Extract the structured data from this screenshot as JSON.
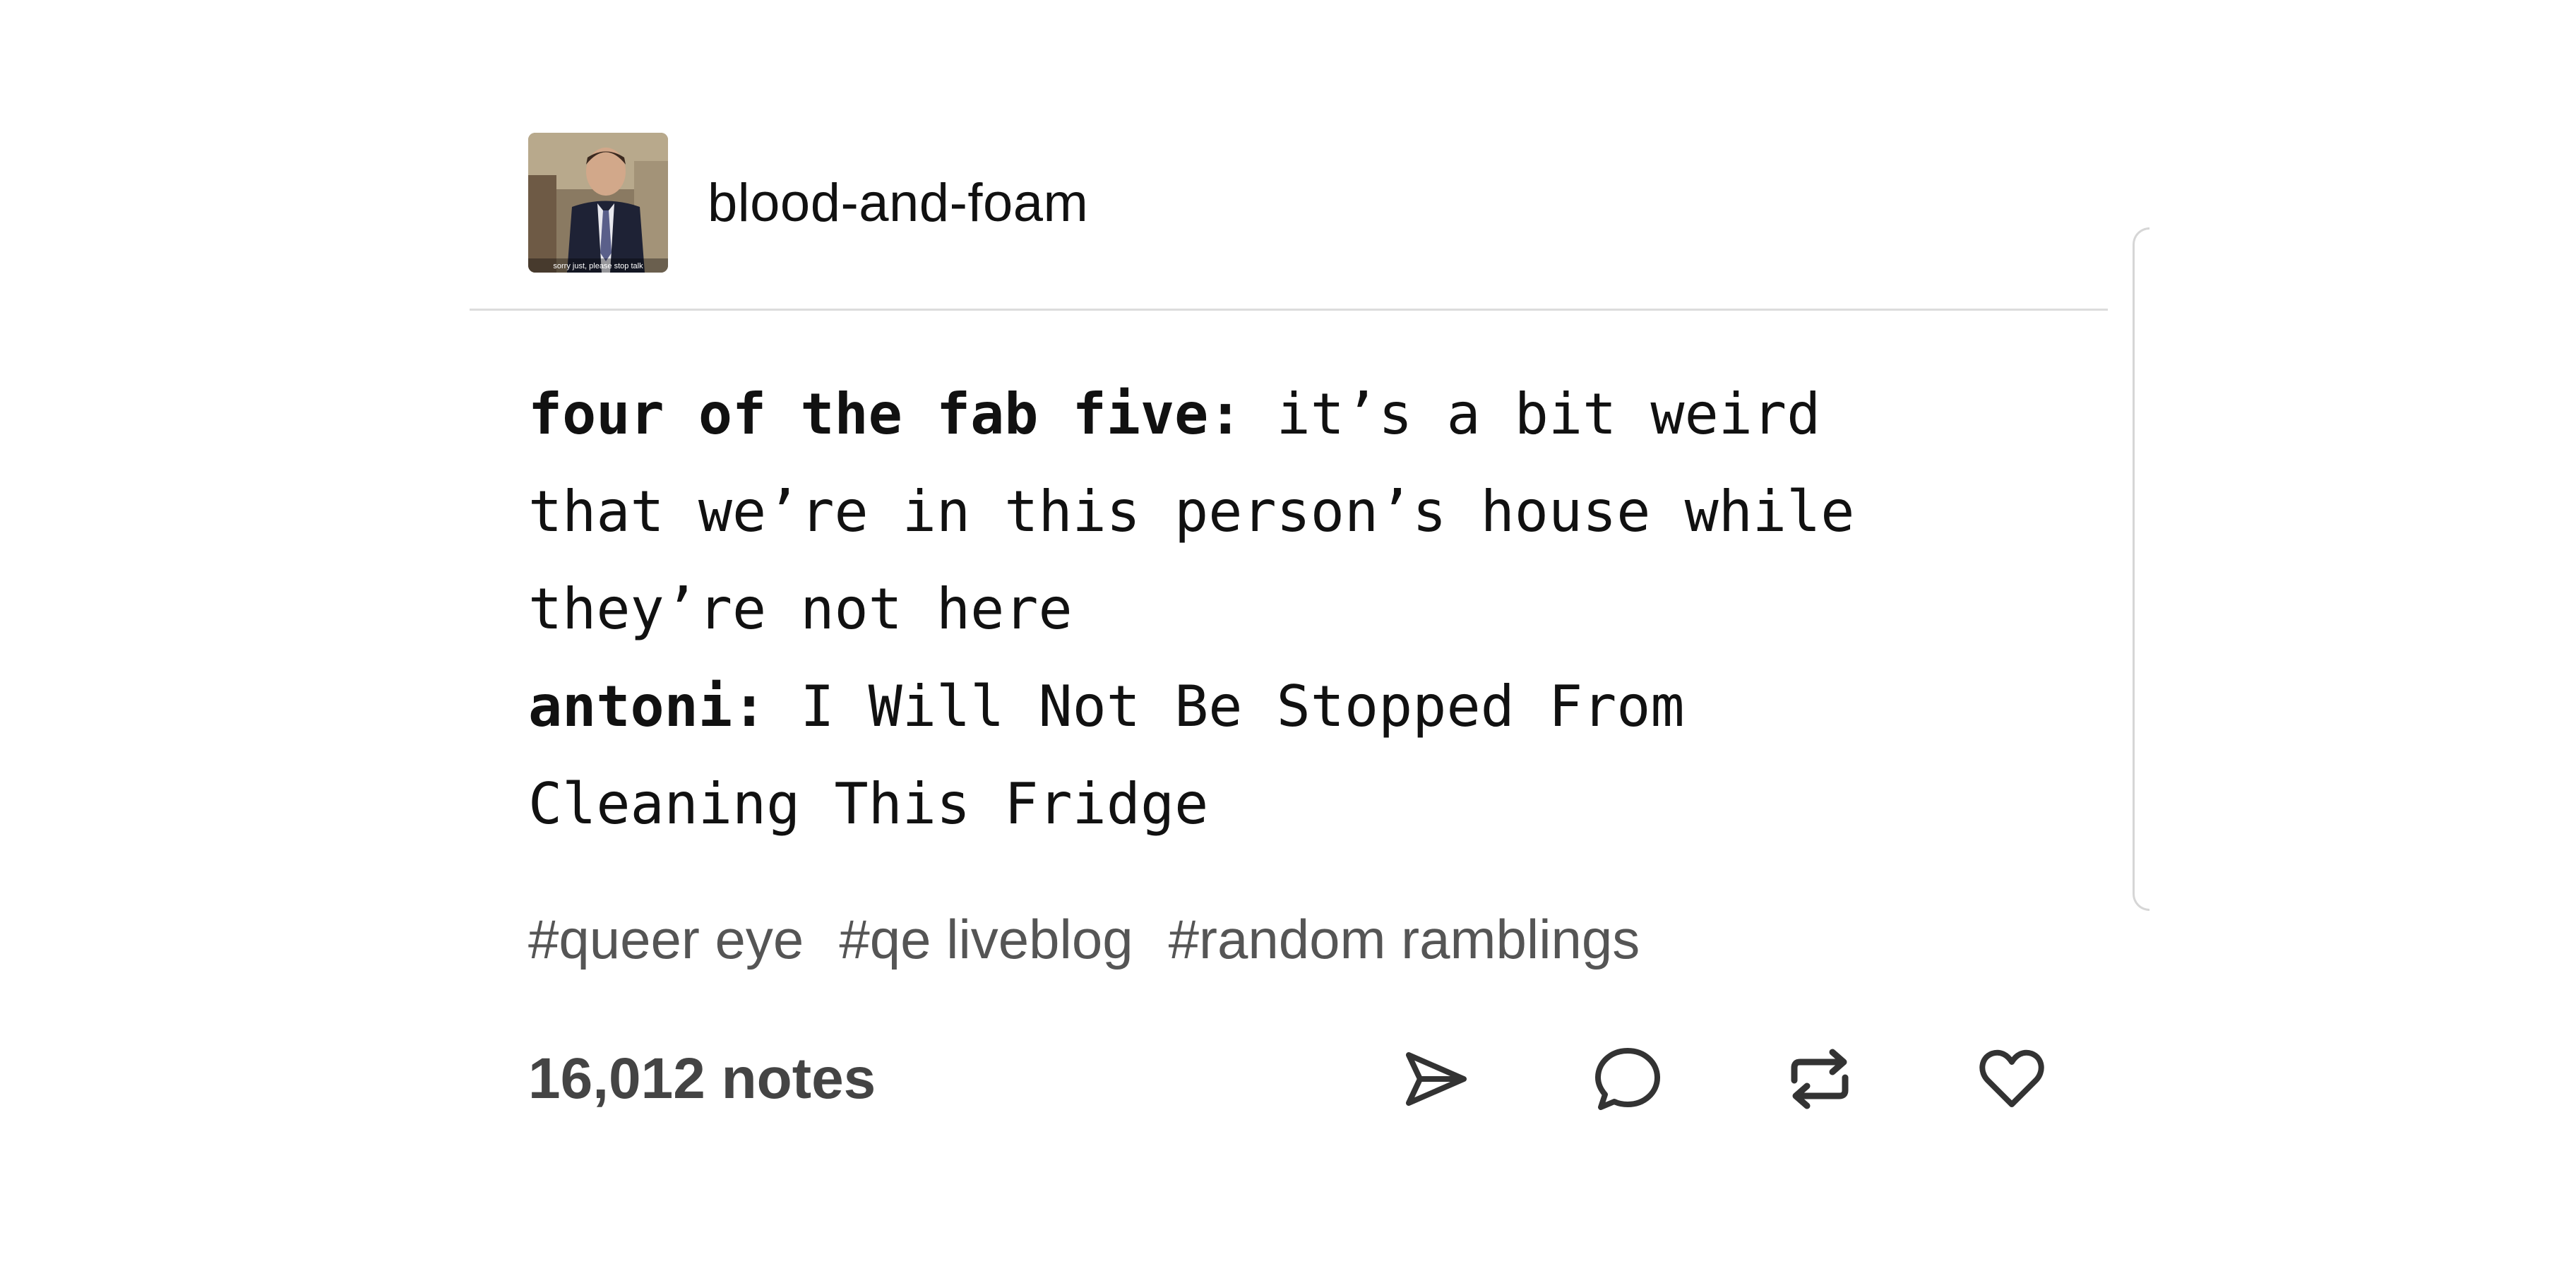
{
  "post": {
    "blog_name": "blood-and-foam",
    "avatar_caption": "sorry just, please stop talk",
    "dialogue": [
      {
        "speaker": "four of the fab five:",
        "lines": [
          "it’s a bit weird",
          "that we’re in this person’s house while",
          "they’re not here"
        ]
      },
      {
        "speaker": "antoni:",
        "lines": [
          "I Will Not Be Stopped From",
          "Cleaning This Fridge"
        ]
      }
    ],
    "tags": [
      "#queer eye",
      "#qe liveblog",
      "#random ramblings"
    ],
    "notes": "16,012 notes",
    "actions": [
      {
        "icon": "send-icon",
        "label": "share"
      },
      {
        "icon": "comment-icon",
        "label": "reply"
      },
      {
        "icon": "reblog-icon",
        "label": "reblog"
      },
      {
        "icon": "heart-icon",
        "label": "like"
      }
    ]
  },
  "colors": {
    "text": "#111111",
    "tags": "#555555",
    "notes": "#444444",
    "divider": "#dcdcdc",
    "icon_stroke": "#333333"
  }
}
